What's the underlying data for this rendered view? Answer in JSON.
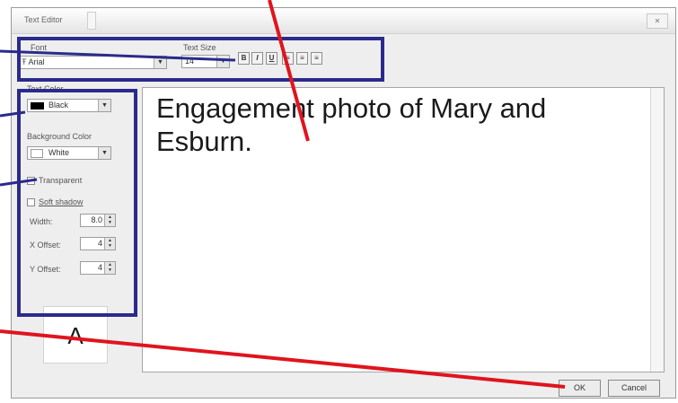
{
  "window": {
    "title": "Text Editor"
  },
  "toolbar": {
    "font_label": "Font",
    "font_value": "Arial",
    "font_icon": "font-type-icon",
    "size_label": "Text Size",
    "size_value": "14",
    "bold": "B",
    "italic": "I",
    "underline": "U",
    "align_left": "≡",
    "align_center": "≡",
    "align_right": "≡"
  },
  "sidebar": {
    "text_color_label": "Text Color",
    "text_color_value": "Black",
    "bg_color_label": "Background Color",
    "bg_color_value": "White",
    "transparent_label": "Transparent",
    "soft_shadow_label": "Soft shadow",
    "width_label": "Width:",
    "width_value": "8.0",
    "x_offset_label": "X Offset:",
    "x_offset_value": "4",
    "y_offset_label": "Y Offset:",
    "y_offset_value": "4",
    "preview_letter": "A"
  },
  "editor": {
    "text": "Engagement photo of Mary and Esburn."
  },
  "buttons": {
    "ok": "OK",
    "cancel": "Cancel"
  },
  "colors": {
    "highlight_box": "#2b2a8c",
    "callout_red": "#e0141e",
    "callout_blue": "#2b2a8c",
    "text_color_swatch": "#000000",
    "bg_color_swatch": "#ffffff"
  }
}
